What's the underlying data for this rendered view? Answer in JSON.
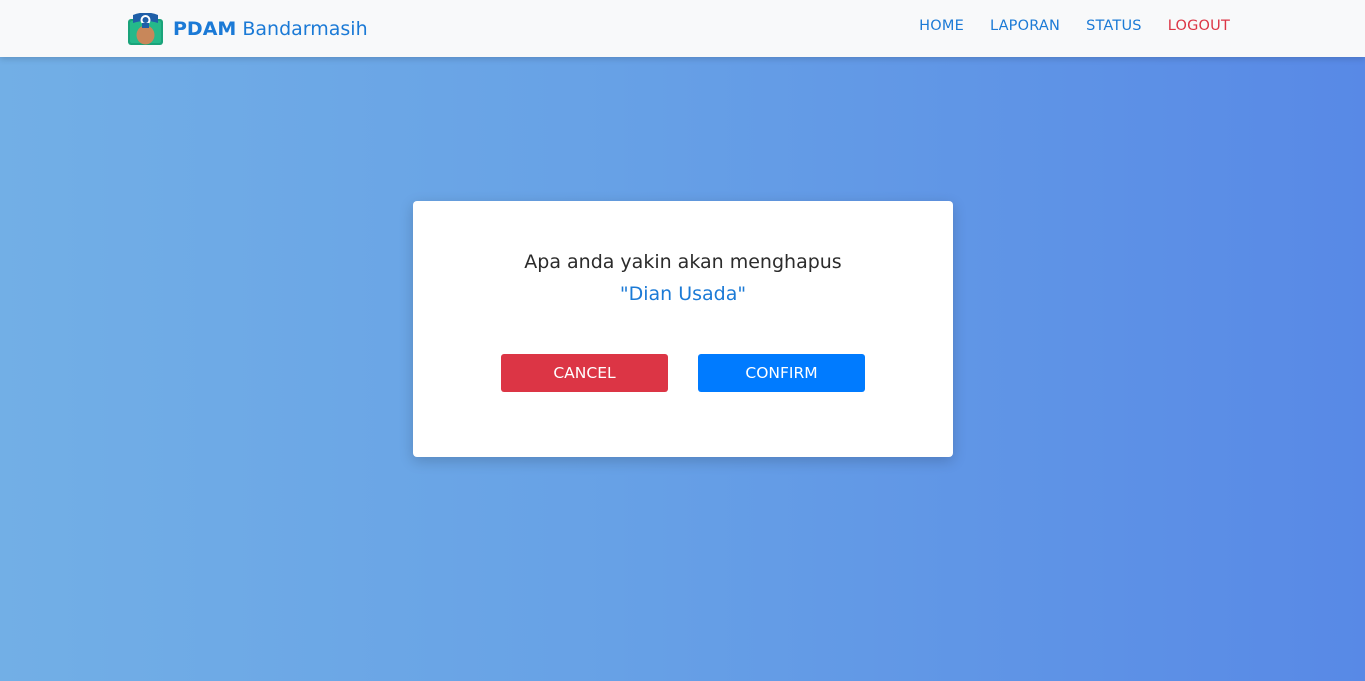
{
  "navbar": {
    "brand": {
      "strong": "PDAM",
      "name": "Bandarmasih",
      "logo_icon": "pdam-logo-icon"
    },
    "links": {
      "home": "HOME",
      "laporan": "LAPORAN",
      "status": "STATUS",
      "logout": "LOGOUT"
    }
  },
  "modal": {
    "question": "Apa anda yakin akan menghapus",
    "target": "\"Dian Usada\"",
    "cancel_label": "CANCEL",
    "confirm_label": "CONFIRM"
  },
  "colors": {
    "brand_blue": "#1b7ad6",
    "danger": "#dc3545",
    "primary": "#007bff",
    "background_start": "#72afe6",
    "background_end": "#5889e6"
  }
}
